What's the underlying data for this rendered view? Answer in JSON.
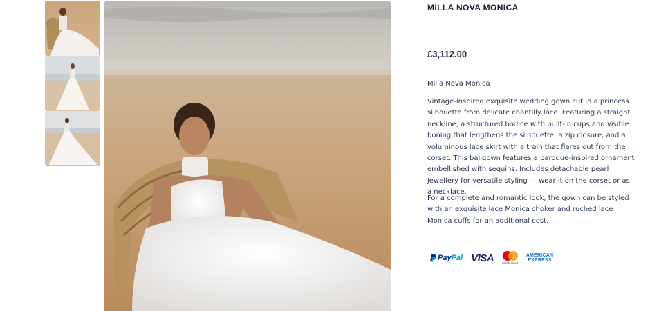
{
  "product": {
    "title": "MILLA NOVA MONICA",
    "price": "£3,112.00",
    "subname": "Milla Nova Monica",
    "description_1": "Vintage-inspired exquisite wedding gown cut in a princess silhouette from delicate chantilly lace. Featuring a straight neckline, a structured bodice with built-in cups and visible boning that lengthens the silhouette, a zip closure, and a voluminous lace skirt with a train that flares out from the corset. This ballgown features a baroque-inspired ornament embellished with sequins. Includes detachable pearl jewellery for versatile styling — wear it on the corset or as a necklace.",
    "description_2": "For a complete and romantic look, the gown can be styled with an exquisite lace Monica choker and ruched lace Monica cuffs for an additional cost."
  },
  "payments": {
    "paypal_a": "Pay",
    "paypal_b": "Pal",
    "visa": "VISA",
    "mastercard_label": "mastercard",
    "amex_line1": "AMERICAN",
    "amex_line2": "EXPRESS",
    "icons": [
      "paypal-icon",
      "visa-icon",
      "mastercard-icon",
      "amex-icon"
    ]
  },
  "colors": {
    "text": "#1d2544",
    "paypal_dark": "#003087",
    "paypal_light": "#009cde",
    "visa": "#1a1f71",
    "amex": "#1f72cd"
  }
}
